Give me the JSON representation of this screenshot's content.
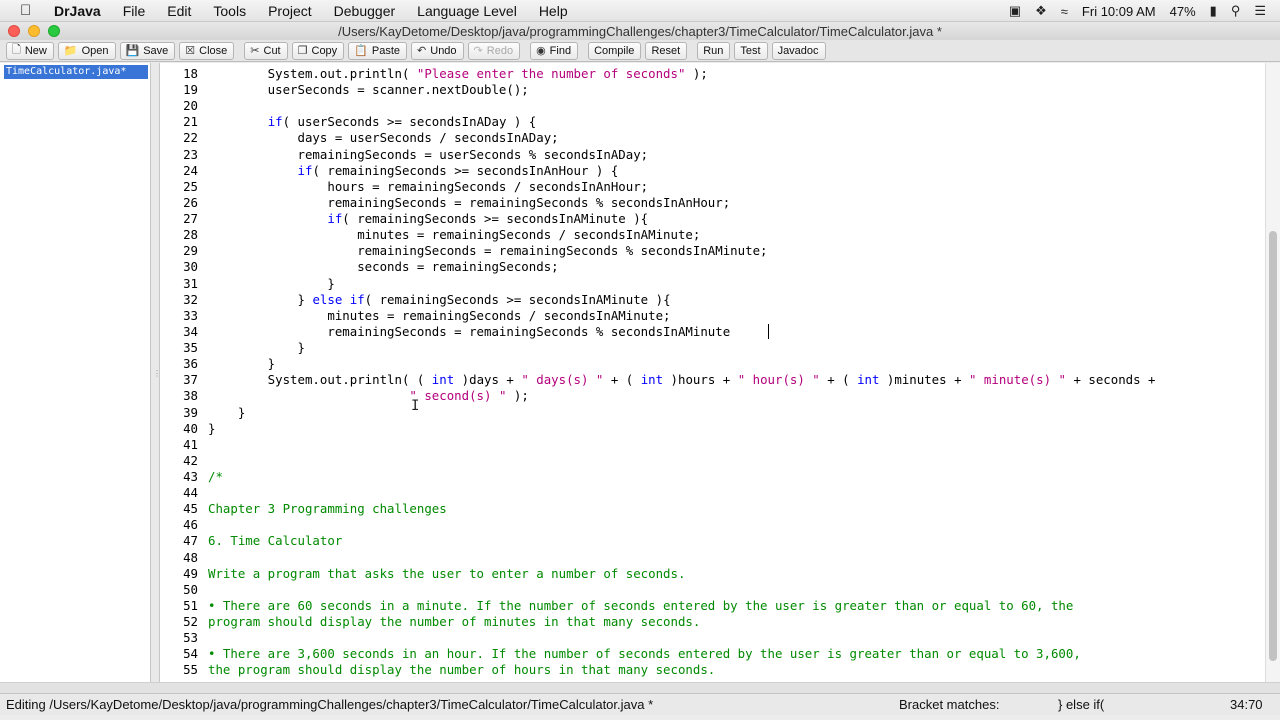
{
  "menubar": {
    "app": "DrJava",
    "items": [
      "File",
      "Edit",
      "Tools",
      "Project",
      "Debugger",
      "Language Level",
      "Help"
    ],
    "clock": "Fri 10:09 AM",
    "battery": "47%"
  },
  "window": {
    "title": "/Users/KayDetome/Desktop/java/programmingChallenges/chapter3/TimeCalculator/TimeCalculator.java *"
  },
  "toolbar": {
    "new": "New",
    "open": "Open",
    "save": "Save",
    "close": "Close",
    "cut": "Cut",
    "copy": "Copy",
    "paste": "Paste",
    "undo": "Undo",
    "redo": "Redo",
    "find": "Find",
    "compile": "Compile",
    "reset": "Reset",
    "run": "Run",
    "test": "Test",
    "javadoc": "Javadoc"
  },
  "doclist": {
    "active_doc": "TimeCalculator.java*"
  },
  "editor": {
    "lines": [
      {
        "n": "18",
        "c": "        System.out.println( \"Please enter the number of seconds\" );"
      },
      {
        "n": "19",
        "c": "        userSeconds = scanner.nextDouble();"
      },
      {
        "n": "20",
        "c": ""
      },
      {
        "n": "21",
        "c": "        if( userSeconds >= secondsInADay ) {"
      },
      {
        "n": "22",
        "c": "            days = userSeconds / secondsInADay;"
      },
      {
        "n": "23",
        "c": "            remainingSeconds = userSeconds % secondsInADay;"
      },
      {
        "n": "24",
        "c": "            if( remainingSeconds >= secondsInAnHour ) {"
      },
      {
        "n": "25",
        "c": "                hours = remainingSeconds / secondsInAnHour;"
      },
      {
        "n": "26",
        "c": "                remainingSeconds = remainingSeconds % secondsInAnHour;"
      },
      {
        "n": "27",
        "c": "                if( remainingSeconds >= secondsInAMinute ){"
      },
      {
        "n": "28",
        "c": "                    minutes = remainingSeconds / secondsInAMinute;"
      },
      {
        "n": "29",
        "c": "                    remainingSeconds = remainingSeconds % secondsInAMinute;"
      },
      {
        "n": "30",
        "c": "                    seconds = remainingSeconds;"
      },
      {
        "n": "31",
        "c": "                }"
      },
      {
        "n": "32",
        "c": "            } else if( remainingSeconds >= secondsInAMinute ){"
      },
      {
        "n": "33",
        "c": "                minutes = remainingSeconds / secondsInAMinute;"
      },
      {
        "n": "34",
        "c": "                remainingSeconds = remainingSeconds % secondsInAMinute"
      },
      {
        "n": "35",
        "c": "            }"
      },
      {
        "n": "36",
        "c": "        }"
      },
      {
        "n": "37",
        "c": "        System.out.println( ( int )days + \" days(s) \" + ( int )hours + \" hour(s) \" + ( int )minutes + \" minute(s) \" + seconds +"
      },
      {
        "n": "38",
        "c": "                           \" second(s) \" );"
      },
      {
        "n": "39",
        "c": "    }"
      },
      {
        "n": "40",
        "c": "}"
      },
      {
        "n": "41",
        "c": ""
      },
      {
        "n": "42",
        "c": ""
      },
      {
        "n": "43",
        "c": "/*"
      },
      {
        "n": "44",
        "c": ""
      },
      {
        "n": "45",
        "c": "Chapter 3 Programming challenges"
      },
      {
        "n": "46",
        "c": ""
      },
      {
        "n": "47",
        "c": "6. Time Calculator"
      },
      {
        "n": "48",
        "c": ""
      },
      {
        "n": "49",
        "c": "Write a program that asks the user to enter a number of seconds."
      },
      {
        "n": "50",
        "c": ""
      },
      {
        "n": "51",
        "c": "• There are 60 seconds in a minute. If the number of seconds entered by the user is greater than or equal to 60, the"
      },
      {
        "n": "52",
        "c": "program should display the number of minutes in that many seconds."
      },
      {
        "n": "53",
        "c": ""
      },
      {
        "n": "54",
        "c": "• There are 3,600 seconds in an hour. If the number of seconds entered by the user is greater than or equal to 3,600,"
      },
      {
        "n": "55",
        "c": "the program should display the number of hours in that many seconds."
      }
    ],
    "comment_start_line": "43"
  },
  "status": {
    "editing": "Editing /Users/KayDetome/Desktop/java/programmingChallenges/chapter3/TimeCalculator/TimeCalculator.java *",
    "bracket_label": "Bracket matches:",
    "bracket_value": "} else if(",
    "position": "34:70"
  },
  "colors": {
    "keyword": "#0000ff",
    "string": "#b4007c",
    "comment": "#008a00",
    "selection": "#3875d7"
  }
}
